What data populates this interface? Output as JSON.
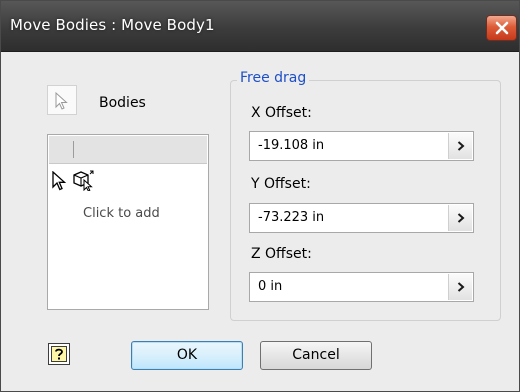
{
  "window": {
    "title": "Move Bodies : Move Body1"
  },
  "selection": {
    "bodies_label": "Bodies",
    "list_placeholder": "Click to add"
  },
  "group": {
    "title": "Free drag",
    "fields": [
      {
        "label": "X Offset:",
        "value": "-19.108 in"
      },
      {
        "label": "Y Offset:",
        "value": "-73.223 in"
      },
      {
        "label": "Z Offset:",
        "value": "0 in"
      }
    ]
  },
  "buttons": {
    "ok": "OK",
    "cancel": "Cancel"
  },
  "icons": {
    "close": "close-icon",
    "select": "select-arrow-icon",
    "pointer": "pointer-icon",
    "body": "body-select-icon",
    "dropdown": "chevron-right-icon",
    "help": "help-icon"
  },
  "colors": {
    "group_title": "#1d4fc7",
    "close_button": "#dd5c38",
    "title_bar": "#3c3c3c"
  }
}
